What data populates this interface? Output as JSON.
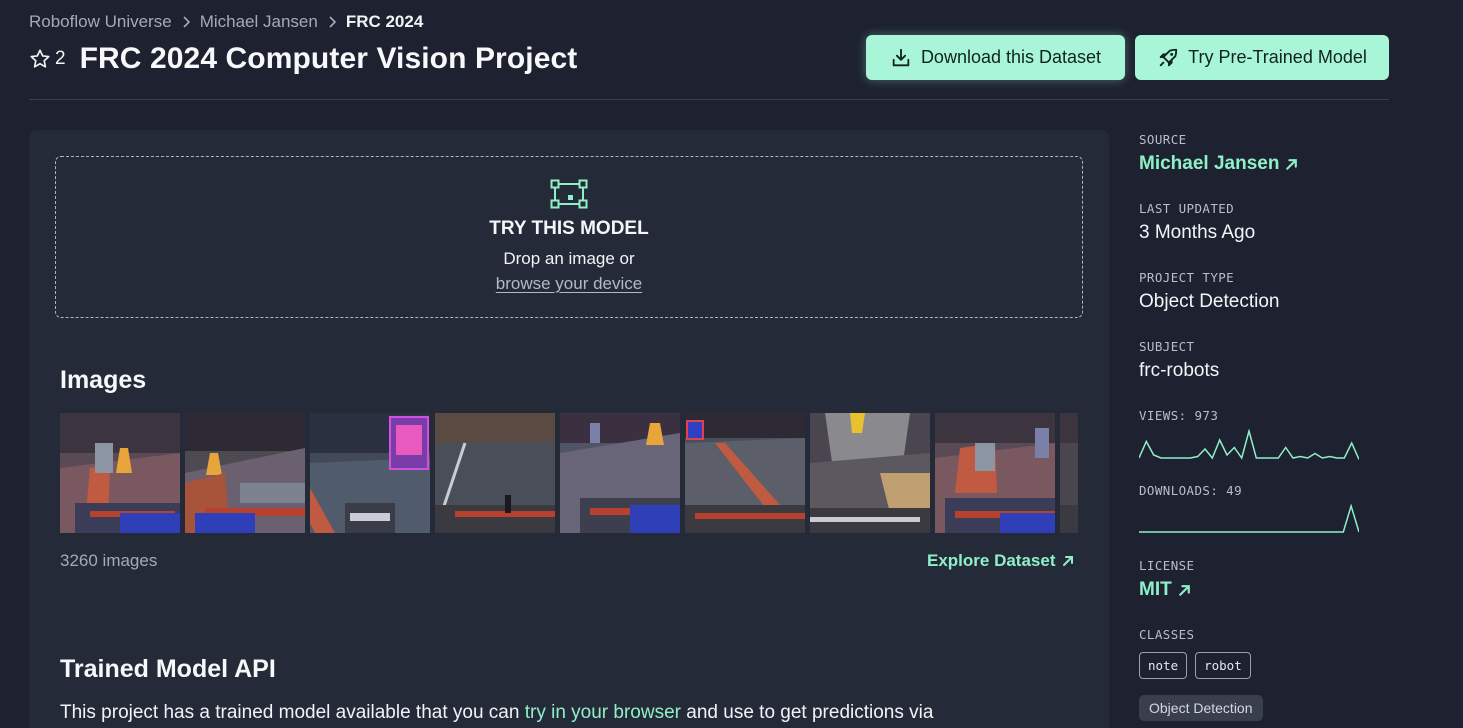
{
  "breadcrumb": {
    "items": [
      "Roboflow Universe",
      "Michael Jansen",
      "FRC 2024"
    ]
  },
  "header": {
    "stars": "2",
    "title": "FRC 2024 Computer Vision Project"
  },
  "actions": {
    "download_label": "Download this Dataset",
    "model_label": "Try Pre-Trained Model"
  },
  "try_model": {
    "title": "TRY THIS MODEL",
    "text": "Drop an image or",
    "link": "browse your device"
  },
  "images": {
    "title": "Images",
    "count": "3260 images",
    "explore_label": "Explore Dataset",
    "thumbnails": [
      "thumb-1",
      "thumb-2",
      "thumb-3",
      "thumb-4",
      "thumb-5",
      "thumb-6",
      "thumb-7",
      "thumb-8",
      "thumb-9"
    ]
  },
  "api": {
    "title": "Trained Model API",
    "text_before": "This project has a trained model available that you can ",
    "link": "try in your browser",
    "text_after": " and use to get predictions via"
  },
  "sidebar": {
    "source_label": "SOURCE",
    "source_value": "Michael Jansen",
    "updated_label": "LAST UPDATED",
    "updated_value": "3 Months Ago",
    "type_label": "PROJECT TYPE",
    "type_value": "Object Detection",
    "subject_label": "SUBJECT",
    "subject_value": "frc-robots",
    "views_label": "VIEWS: 973",
    "downloads_label": "DOWNLOADS: 49",
    "license_label": "LICENSE",
    "license_value": "MIT",
    "classes_label": "CLASSES",
    "classes": [
      "note",
      "robot"
    ],
    "tag": "Object Detection"
  },
  "colors": {
    "accent": "#a8f5d7",
    "accent_text": "#8ff0c8",
    "background": "#1d2130",
    "card": "#252a39"
  },
  "sparklines": {
    "views": [
      0.1,
      0.65,
      0.2,
      0.1,
      0.1,
      0.1,
      0.1,
      0.1,
      0.15,
      0.4,
      0.1,
      0.7,
      0.2,
      0.45,
      0.1,
      1.0,
      0.1,
      0.1,
      0.1,
      0.1,
      0.45,
      0.1,
      0.15,
      0.1,
      0.25,
      0.1,
      0.15,
      0.1,
      0.1,
      0.6,
      0.05
    ],
    "downloads": [
      0.0,
      0.0,
      0.0,
      0.0,
      0.0,
      0.0,
      0.0,
      0.0,
      0.0,
      0.0,
      0.0,
      0.0,
      0.0,
      0.0,
      0.0,
      0.0,
      0.0,
      0.0,
      0.0,
      0.0,
      0.0,
      0.0,
      0.0,
      0.0,
      0.0,
      0.0,
      0.0,
      1.0,
      0.0
    ]
  }
}
